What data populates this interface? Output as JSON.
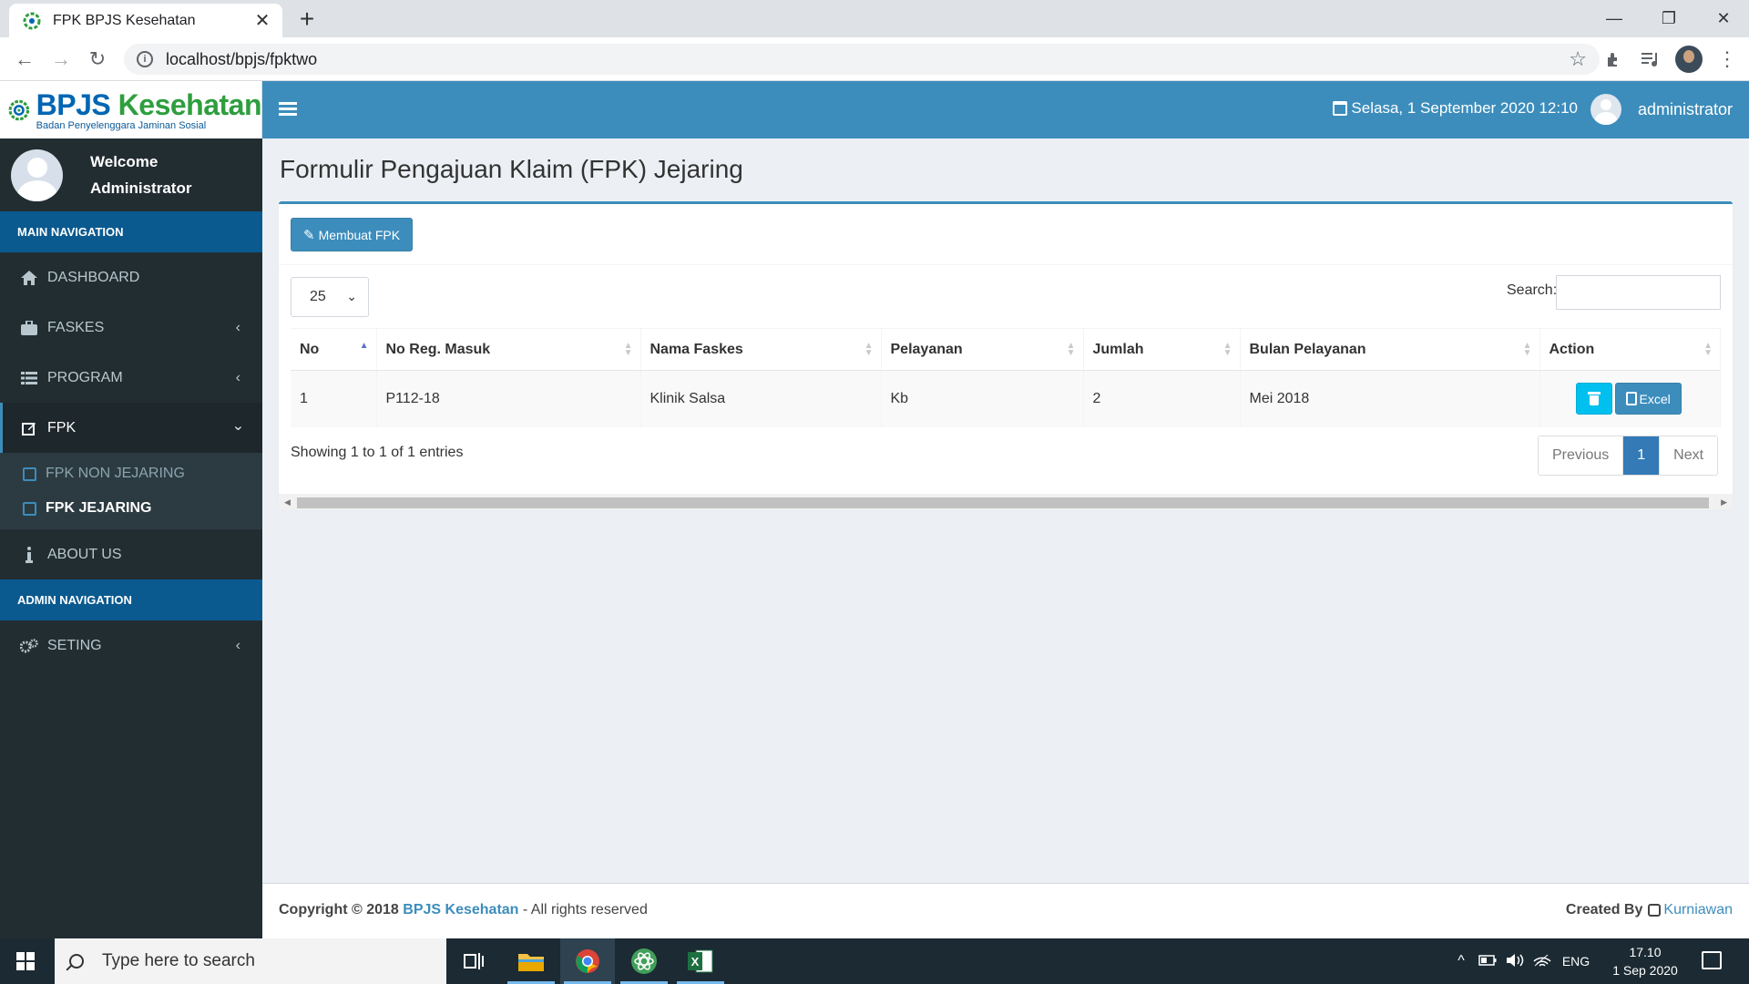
{
  "browser": {
    "tab_title": "FPK BPJS Kesehatan",
    "url": "localhost/bpjs/fpktwo"
  },
  "brand": {
    "name_part1": "BPJS ",
    "name_part2": "Kesehatan",
    "subtitle": "Badan Penyelenggara Jaminan Sosial",
    "primary_color": "#3c8dbc",
    "sidebar_color": "#222d32"
  },
  "topbar": {
    "datetime": "Selasa, 1 September 2020 12:10",
    "username": "administrator"
  },
  "sidebar": {
    "welcome_line1": "Welcome",
    "welcome_line2": "Administrator",
    "main_header": "MAIN NAVIGATION",
    "items": [
      {
        "label": "DASHBOARD",
        "icon": "home-icon"
      },
      {
        "label": "FASKES",
        "icon": "briefcase-icon"
      },
      {
        "label": "PROGRAM",
        "icon": "list-icon"
      },
      {
        "label": "FPK",
        "icon": "edit-icon"
      }
    ],
    "fpk_sub": [
      "FPK NON JEJARING",
      "FPK JEJARING"
    ],
    "about": "ABOUT US",
    "admin_header": "ADMIN NAVIGATION",
    "setting": "SETING"
  },
  "page": {
    "title": "Formulir Pengajuan Klaim (FPK) Jejaring",
    "create_button": "Membuat FPK",
    "page_length": "25",
    "search_label": "Search:",
    "search_value": "",
    "columns": [
      "No",
      "No Reg. Masuk",
      "Nama Faskes",
      "Pelayanan",
      "Jumlah",
      "Bulan Pelayanan",
      "Action"
    ],
    "rows": [
      {
        "no": "1",
        "reg": "P112-18",
        "faskes": "Klinik Salsa",
        "pelayanan": "Kb",
        "jumlah": "2",
        "bulan": "Mei 2018"
      }
    ],
    "excel_button": "Excel",
    "info": "Showing 1 to 1 of 1 entries",
    "pager": {
      "previous": "Previous",
      "current": "1",
      "next": "Next"
    }
  },
  "footer": {
    "copyright": "Copyright © 2018",
    "link": "BPJS Kesehatan",
    "rights": "- All rights reserved",
    "created_by": "Created By",
    "author": "Kurniawan"
  },
  "taskbar": {
    "search_placeholder": "Type here to search",
    "lang": "ENG",
    "time": "17.10",
    "date": "1 Sep 2020"
  }
}
